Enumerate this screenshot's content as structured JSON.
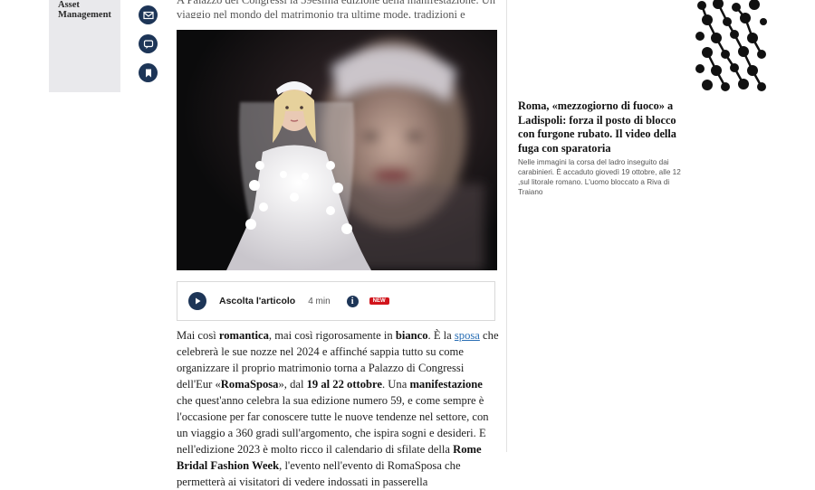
{
  "ad": {
    "line1": "Asset",
    "line2": "Management"
  },
  "share": {
    "email_icon": "envelope-icon",
    "comment_icon": "chat-bubble-icon",
    "bookmark_icon": "bookmark-icon"
  },
  "article": {
    "lead": "A Palazzo dei Congressi la 39esima edizione della manifestazione. Un viaggio nel mondo del matrimonio tra ultime mode, tradizioni e galateo",
    "audio": {
      "label": "Ascolta l'articolo",
      "duration": "4 min",
      "info": "i",
      "badge": "NEW"
    },
    "body": {
      "s1": "Mai così ",
      "b1": "romantica",
      "s2": ", mai così rigorosamente in ",
      "b2": "bianco",
      "s3": ".  È la ",
      "link": "sposa",
      "s4": " che celebrerà le sue nozze nel 2024 e affinché sappia tutto su come organizzare il proprio matrimonio torna a Palazzo di Congressi dell'Eur «",
      "b3": "RomaSposa",
      "s5": "», dal ",
      "b4": "19 al 22 ottobre",
      "s6": ". Una ",
      "b5": "manifestazione",
      "s7": " che quest'anno celebra la sua edizione numero 59,  e come sempre è l'occasione per far conoscere tutte le nuove tendenze nel settore, con un viaggio a 360 gradi sull'argomento, che ispira sogni e desideri. E nell'edizione 2023 è molto ricco il calendario di sfilate della ",
      "b6": "Rome Bridal Fashion Week",
      "s8": ", l'evento nell'evento di RomaSposa che permetterà ai visitatori di vedere indossati in passerella"
    }
  },
  "sidebar": {
    "news_title": "Roma, «mezzogiorno di fuoco» a Ladispoli: forza il posto di blocco con furgone rubato. Il video della fuga con sparatoria",
    "news_summary": "Nelle immagini la corsa del ladro inseguito dai carabinieri. È accaduto giovedì 19 ottobre, alle 12 ,sul litorale romano. L'uomo bloccato a Riva di Traiano"
  },
  "colors": {
    "accent": "#1d3557",
    "badge": "#d1141b",
    "link": "#2a6fb5"
  }
}
